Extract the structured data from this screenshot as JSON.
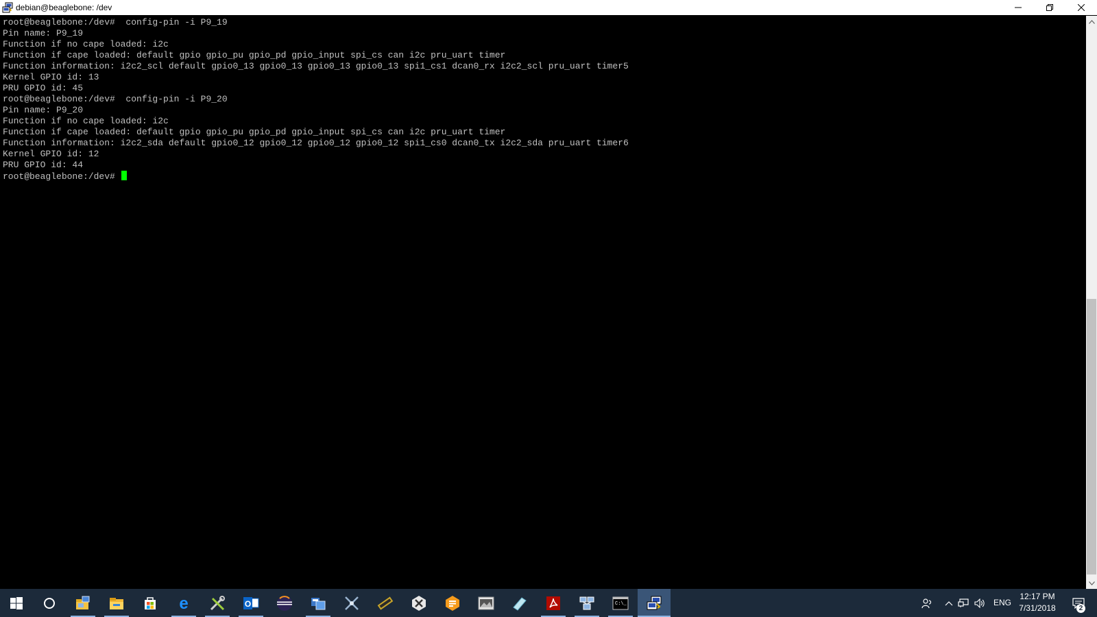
{
  "window": {
    "title": "debian@beaglebone: /dev",
    "icon": "putty-icon"
  },
  "terminal": {
    "lines": [
      "root@beaglebone:/dev#  config-pin -i P9_19",
      "Pin name: P9_19",
      "Function if no cape loaded: i2c",
      "Function if cape loaded: default gpio gpio_pu gpio_pd gpio_input spi_cs can i2c pru_uart timer",
      "Function information: i2c2_scl default gpio0_13 gpio0_13 gpio0_13 gpio0_13 spi1_cs1 dcan0_rx i2c2_scl pru_uart timer5",
      "Kernel GPIO id: 13",
      "PRU GPIO id: 45",
      "root@beaglebone:/dev#  config-pin -i P9_20",
      "Pin name: P9_20",
      "Function if no cape loaded: i2c",
      "Function if cape loaded: default gpio gpio_pu gpio_pd gpio_input spi_cs can i2c pru_uart timer",
      "Function information: i2c2_sda default gpio0_12 gpio0_12 gpio0_12 gpio0_12 spi1_cs0 dcan0_tx i2c2_sda pru_uart timer6",
      "Kernel GPIO id: 12",
      "PRU GPIO id: 44"
    ],
    "prompt": "root@beaglebone:/dev# ",
    "text_color": "#c0c0c0",
    "cursor_color": "#00ff00",
    "background": "#000000"
  },
  "taskbar": {
    "background": "#1c2a3a",
    "apps": [
      {
        "name": "start-icon"
      },
      {
        "name": "cortana-search-icon"
      },
      {
        "name": "network-folder-icon",
        "running": true
      },
      {
        "name": "file-explorer-icon",
        "running": true
      },
      {
        "name": "store-icon"
      },
      {
        "name": "edge-icon",
        "running": true
      },
      {
        "name": "tools-icon",
        "running": true
      },
      {
        "name": "outlook-icon",
        "running": true
      },
      {
        "name": "eclipse-icon"
      },
      {
        "name": "package-icon",
        "running": true
      },
      {
        "name": "crossed-tools-icon"
      },
      {
        "name": "board-icon"
      },
      {
        "name": "x-app-icon"
      },
      {
        "name": "sublime-icon"
      },
      {
        "name": "image-viewer-icon"
      },
      {
        "name": "pen-app-icon"
      },
      {
        "name": "acrobat-icon",
        "running": true
      },
      {
        "name": "network-computers-icon",
        "running": true
      },
      {
        "name": "command-prompt-icon",
        "running": true
      },
      {
        "name": "putty-icon",
        "running": true,
        "active": true
      }
    ],
    "tray": {
      "language": "ENG",
      "time": "12:17 PM",
      "date": "7/31/2018",
      "notifications": "2"
    }
  }
}
